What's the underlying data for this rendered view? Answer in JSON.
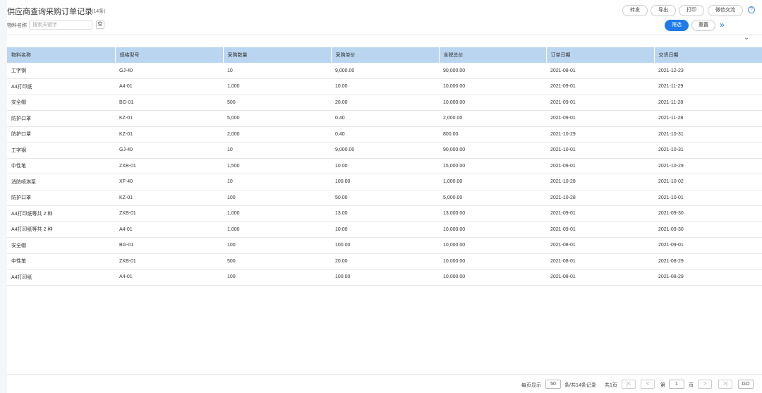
{
  "header": {
    "title": "供应商查询采购订单记录",
    "count": "(14条)",
    "filter_label": "物料名称",
    "search_placeholder": "搜索关键字",
    "clear_label": "空",
    "actions": [
      "转发",
      "导出",
      "打印",
      "微信交流"
    ],
    "help_label": "?"
  },
  "filter": {
    "submit_label": "筛选",
    "reset_label": "重置",
    "expand_label": "»",
    "collapse_label": "⌄"
  },
  "table": {
    "columns": [
      "物料名称",
      "规格型号",
      "采购数量",
      "采购单价",
      "含税总价",
      "订单日期",
      "交货日期"
    ],
    "rows": [
      [
        "工字钢",
        "GJ-40",
        "10",
        "9,000.00",
        "90,000.00",
        "2021-08-01",
        "2021-12-23"
      ],
      [
        "A4打印纸",
        "A4-01",
        "1,000",
        "10.00",
        "10,000.00",
        "2021-09-01",
        "2021-11-29"
      ],
      [
        "安全帽",
        "BG-01",
        "500",
        "20.00",
        "10,000.00",
        "2021-09-01",
        "2021-11-28"
      ],
      [
        "防护口罩",
        "KZ-01",
        "5,000",
        "0.40",
        "2,000.00",
        "2021-09-01",
        "2021-11-28"
      ],
      [
        "防护口罩",
        "KZ-01",
        "2,000",
        "0.40",
        "800.00",
        "2021-10-29",
        "2021-10-31"
      ],
      [
        "工字钢",
        "GJ-40",
        "10",
        "9,000.00",
        "90,000.00",
        "2021-10-01",
        "2021-10-31"
      ],
      [
        "中性笔",
        "ZXB-01",
        "1,500",
        "10.00",
        "15,000.00",
        "2021-09-01",
        "2021-10-29"
      ],
      [
        "消防喷淋泵",
        "XF-40",
        "10",
        "100.00",
        "1,000.00",
        "2021-10-28",
        "2021-10-02"
      ],
      [
        "防护口罩",
        "KZ-01",
        "100",
        "50.00",
        "5,000.00",
        "2021-10-28",
        "2021-10-01"
      ],
      [
        "A4打印纸等共 2 种",
        "ZXB-01",
        "1,000",
        "13.00",
        "13,000.00",
        "2021-09-01",
        "2021-09-30"
      ],
      [
        "A4打印纸等共 2 种",
        "A4-01",
        "1,000",
        "10.00",
        "10,000.00",
        "2021-09-01",
        "2021-09-30"
      ],
      [
        "安全帽",
        "BG-01",
        "100",
        "100.00",
        "10,000.00",
        "2021-08-01",
        "2021-09-01"
      ],
      [
        "中性笔",
        "ZXB-01",
        "500",
        "20.00",
        "10,000.00",
        "2021-08-01",
        "2021-08-29"
      ],
      [
        "A4打印纸",
        "A4-01",
        "100",
        "100.00",
        "10,000.00",
        "2021-08-01",
        "2021-08-29"
      ]
    ]
  },
  "pagination": {
    "per_page_label": "每页显示",
    "per_page_value": "50",
    "total_label": "条/共14条记录",
    "pages_label": "共1页",
    "first_label": "|<",
    "prev_label": "<",
    "page_prefix": "第",
    "current_page": "1",
    "page_suffix": "页",
    "next_label": ">",
    "last_label": ">|",
    "go_label": "GO"
  }
}
